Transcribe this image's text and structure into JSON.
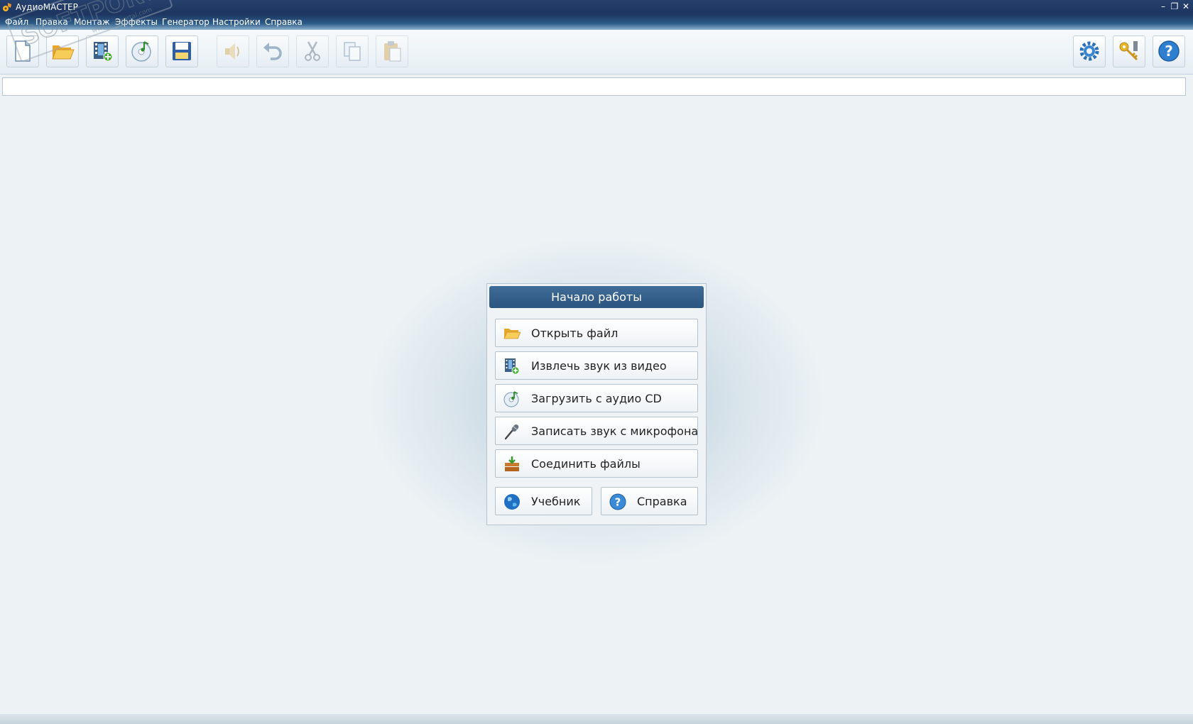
{
  "window": {
    "title": "АудиоМАСТЕР",
    "controls": {
      "minimize": "–",
      "restore": "❐",
      "close": "✕"
    }
  },
  "menu": [
    "Файл",
    "Правка",
    "Монтаж",
    "Эффекты",
    "Генератор",
    "Настройки",
    "Справка"
  ],
  "toolbar": {
    "left": [
      {
        "icon": "new-file-icon",
        "enabled": true
      },
      {
        "icon": "open-folder-icon",
        "enabled": true
      },
      {
        "icon": "extract-video-icon",
        "enabled": true
      },
      {
        "icon": "audio-cd-icon",
        "enabled": true
      },
      {
        "icon": "save-icon",
        "enabled": true
      },
      {
        "icon": "speaker-icon",
        "enabled": false
      },
      {
        "icon": "undo-icon",
        "enabled": false
      },
      {
        "icon": "cut-icon",
        "enabled": false
      },
      {
        "icon": "copy-icon",
        "enabled": false
      },
      {
        "icon": "paste-icon",
        "enabled": false
      }
    ],
    "right": [
      {
        "icon": "settings-icon"
      },
      {
        "icon": "keys-icon"
      },
      {
        "icon": "help-icon"
      }
    ]
  },
  "dialog": {
    "title": "Начало работы",
    "actions": [
      {
        "icon": "open-folder-icon",
        "label": "Открыть файл"
      },
      {
        "icon": "extract-video-icon",
        "label": "Извлечь звук из видео"
      },
      {
        "icon": "audio-cd-icon",
        "label": "Загрузить с аудио CD"
      },
      {
        "icon": "microphone-icon",
        "label": "Записать звук с микрофона"
      },
      {
        "icon": "join-files-icon",
        "label": "Соединить файлы"
      }
    ],
    "tutorial_label": "Учебник",
    "help_label": "Справка"
  },
  "watermark": {
    "text": "SOFTPORTAL",
    "url": "www.softportal.com",
    "tm": "™"
  },
  "colors": {
    "titlebar": "#1d3560",
    "dialog_header": "#355f8a",
    "background": "#edf2f5"
  }
}
